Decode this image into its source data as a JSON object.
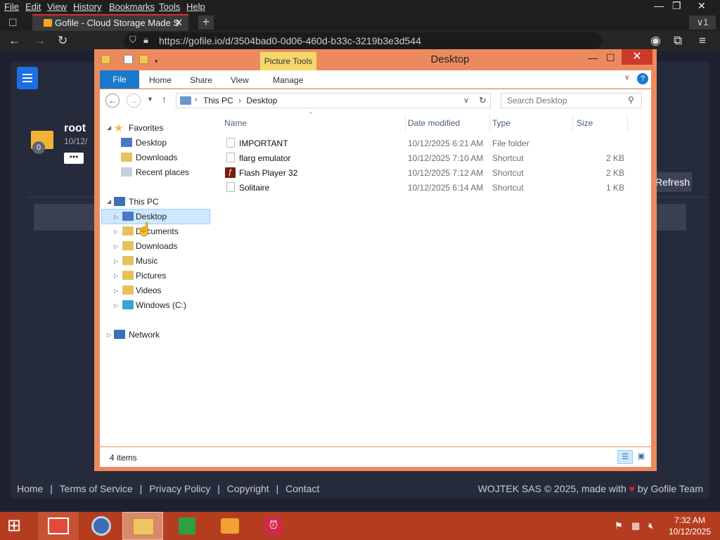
{
  "browser": {
    "menu": [
      "File",
      "Edit",
      "View",
      "History",
      "Bookmarks",
      "Tools",
      "Help"
    ],
    "tab_title": "Gofile - Cloud Storage Made Simple",
    "tab_menu": "∨1",
    "url": "https://gofile.io/d/3504bad0-0d06-460d-b33c-3219b3e3d544"
  },
  "page": {
    "folder_badge": "0",
    "folder_name": "root",
    "folder_date": "10/12/",
    "more": "•••",
    "refresh": "Refresh",
    "footer_links": [
      "Home",
      "|",
      "Terms of Service",
      "|",
      "Privacy Policy",
      "|",
      "Copyright",
      "|",
      "Contact"
    ],
    "footer_copyright": "WOJTEK SAS © 2025, made with",
    "footer_by": "by Gofile Team"
  },
  "explorer": {
    "title": "Desktop",
    "picture_tools": "Picture Tools",
    "ribbon_tabs": [
      "File",
      "Home",
      "Share",
      "View",
      "Manage"
    ],
    "breadcrumb": [
      "This PC",
      "Desktop"
    ],
    "search_placeholder": "Search Desktop",
    "nav": {
      "favorites": "Favorites",
      "fav_items": [
        "Desktop",
        "Downloads",
        "Recent places"
      ],
      "this_pc": "This PC",
      "pc_items": [
        "Desktop",
        "Documents",
        "Downloads",
        "Music",
        "Pictures",
        "Videos",
        "Windows (C:)"
      ],
      "network": "Network"
    },
    "columns": [
      "Name",
      "Date modified",
      "Type",
      "Size"
    ],
    "files": [
      {
        "name": "IMPORTANT",
        "date": "10/12/2025 6:21 AM",
        "type": "File folder",
        "size": ""
      },
      {
        "name": "flarg emulator",
        "date": "10/12/2025 7:10 AM",
        "type": "Shortcut",
        "size": "2 KB"
      },
      {
        "name": "Flash Player 32",
        "date": "10/12/2025 7:12 AM",
        "type": "Shortcut",
        "size": "2 KB"
      },
      {
        "name": "Solitaire",
        "date": "10/12/2025 6:14 AM",
        "type": "Shortcut",
        "size": "1 KB"
      }
    ],
    "status": "4 items"
  },
  "taskbar": {
    "time": "7:32 AM",
    "date": "10/12/2025"
  },
  "colors": {
    "accent": "#1979ca",
    "window_frame": "#ec8a5e",
    "taskbar": "#b53d1f",
    "selection": "#cde8ff"
  }
}
